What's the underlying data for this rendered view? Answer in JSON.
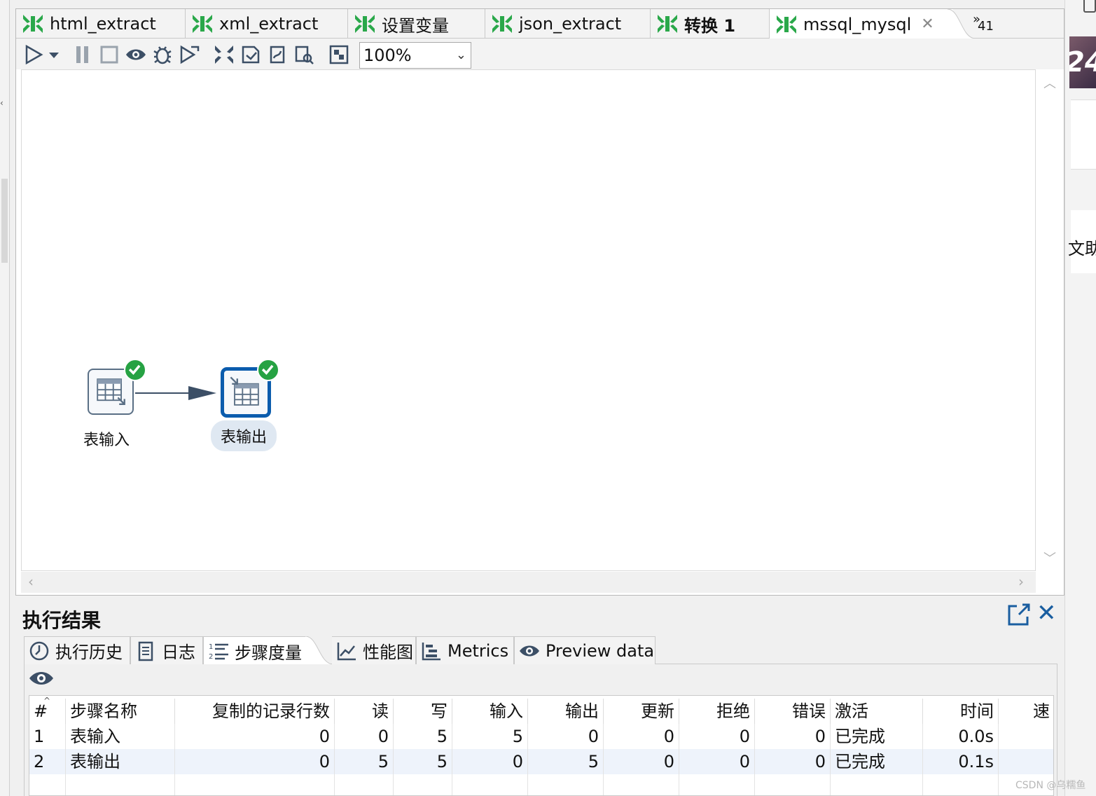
{
  "tabs": [
    {
      "label": "html_extract"
    },
    {
      "label": "xml_extract"
    },
    {
      "label": "设置变量"
    },
    {
      "label": "json_extract"
    },
    {
      "label": "转换 1"
    },
    {
      "label": "mssql_mysql"
    }
  ],
  "tab_overflow": {
    "glyph": "»",
    "count": "41"
  },
  "toolbar": {
    "zoom_value": "100%"
  },
  "canvas": {
    "steps": [
      {
        "label": "表输入",
        "status": "success"
      },
      {
        "label": "表输出",
        "status": "success",
        "selected": true
      }
    ]
  },
  "results": {
    "title": "执行结果",
    "tabs": [
      {
        "label": "执行历史",
        "icon": "clock-icon"
      },
      {
        "label": "日志",
        "icon": "log-icon"
      },
      {
        "label": "步骤度量",
        "icon": "numbered-list-icon"
      },
      {
        "label": "性能图",
        "icon": "chart-icon"
      },
      {
        "label": "Metrics",
        "icon": "gantt-icon"
      },
      {
        "label": "Preview data",
        "icon": "eye-icon"
      }
    ],
    "table": {
      "columns": [
        "#",
        "步骤名称",
        "复制的记录行数",
        "读",
        "写",
        "输入",
        "输出",
        "更新",
        "拒绝",
        "错误",
        "激活",
        "时间",
        "速"
      ],
      "rows": [
        [
          "1",
          "表输入",
          "0",
          "0",
          "5",
          "5",
          "0",
          "0",
          "0",
          "0",
          "已完成",
          "0.0s",
          ""
        ],
        [
          "2",
          "表输出",
          "0",
          "5",
          "5",
          "0",
          "5",
          "0",
          "0",
          "0",
          "已完成",
          "0.1s",
          ""
        ]
      ]
    }
  },
  "side": {
    "badge_text": "24",
    "cut_text": "文助"
  },
  "watermark": "CSDN @乌糯鱼",
  "colors": {
    "accent": "#0b5cad",
    "success": "#26a243",
    "tab_icon_green": "#2aa84a"
  }
}
